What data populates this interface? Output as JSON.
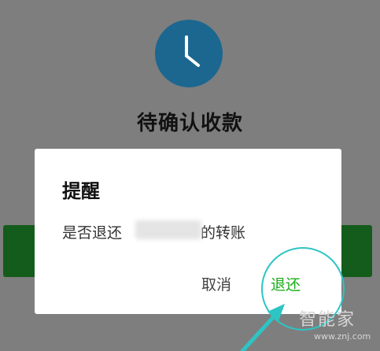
{
  "background": {
    "page_title": "待确认收款"
  },
  "dialog": {
    "title": "提醒",
    "message_prefix": "是否退还",
    "message_suffix": "的转账",
    "cancel_label": "取消",
    "return_label": "退还"
  },
  "watermark": {
    "brand": "智能家",
    "domain": "www.znj.com"
  },
  "colors": {
    "clock_bg": "#1b6790",
    "green_button": "#145c1b",
    "return_text": "#1aad19",
    "highlight": "#2ec4c4"
  },
  "icons": {
    "clock": "clock-icon"
  }
}
